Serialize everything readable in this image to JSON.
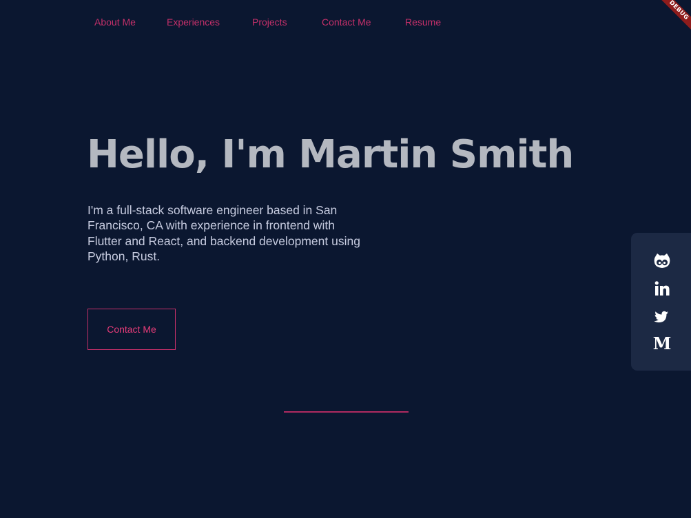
{
  "nav": {
    "items": [
      {
        "label": "About Me"
      },
      {
        "label": "Experiences"
      },
      {
        "label": "Projects"
      },
      {
        "label": "Contact Me"
      },
      {
        "label": "Resume"
      }
    ]
  },
  "hero": {
    "title": "Hello, I'm Martin Smith",
    "description": "I'm a full-stack software engineer based in San Francisco, CA with experience in frontend with Flutter and React, and backend development using Python, Rust.",
    "contact_button": "Contact Me"
  },
  "social": {
    "icons": [
      "github-icon",
      "linkedin-icon",
      "twitter-icon",
      "medium-icon"
    ],
    "medium_glyph": "M"
  },
  "debug_banner": {
    "label": "DEBUG"
  },
  "colors": {
    "background": "#0b1730",
    "accent": "#c6306a",
    "title": "#b4b8c0",
    "body_text": "#c7cce0",
    "panel": "#1c2944",
    "debug": "#8e1c1c"
  }
}
